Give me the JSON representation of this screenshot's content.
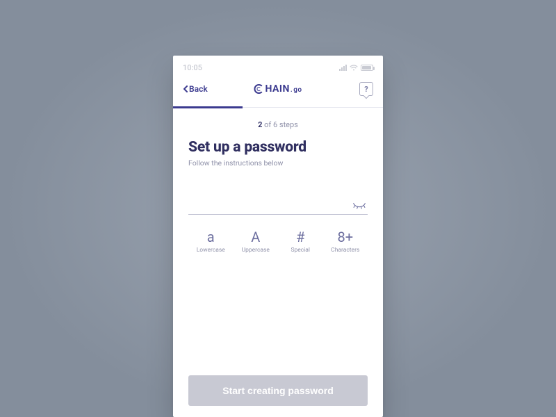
{
  "statusbar": {
    "time": "10:05"
  },
  "header": {
    "back_label": "Back",
    "logo_main": "HAIN",
    "logo_suffix": "go",
    "help_label": "?"
  },
  "progress": {
    "current_step": "2",
    "step_text_prefix": " of ",
    "total_steps": "6",
    "step_text_suffix": " steps"
  },
  "page": {
    "title": "Set up a password",
    "subtitle": "Follow the instructions below"
  },
  "password": {
    "value": "",
    "placeholder": ""
  },
  "requirements": [
    {
      "glyph": "a",
      "label": "Lowercase"
    },
    {
      "glyph": "A",
      "label": "Uppercase"
    },
    {
      "glyph": "#",
      "label": "Special"
    },
    {
      "glyph": "8+",
      "label": "Characters"
    }
  ],
  "cta": {
    "label": "Start creating password"
  }
}
